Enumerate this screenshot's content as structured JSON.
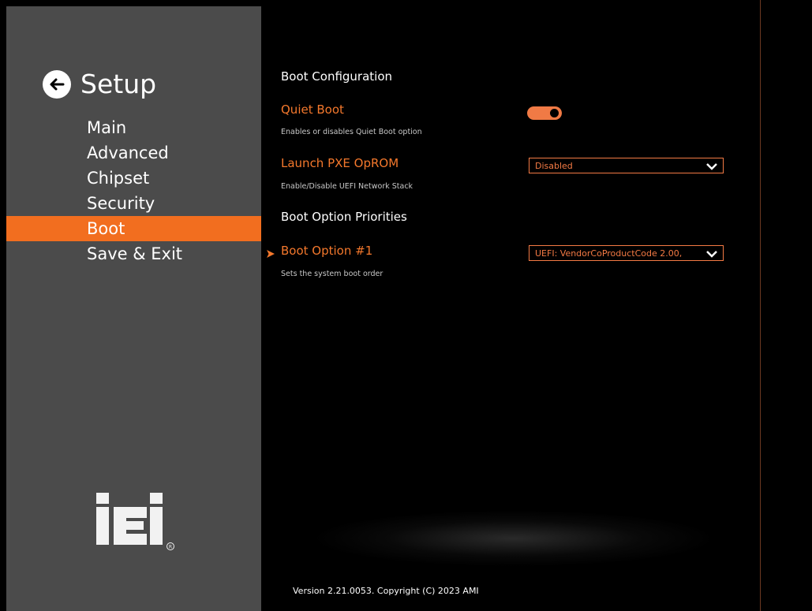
{
  "sidebar": {
    "title": "Setup",
    "items": [
      {
        "label": "Main"
      },
      {
        "label": "Advanced"
      },
      {
        "label": "Chipset"
      },
      {
        "label": "Security"
      },
      {
        "label": "Boot"
      },
      {
        "label": "Save & Exit"
      }
    ],
    "active_item": "Boot",
    "logo_text": "iEi"
  },
  "main": {
    "section_boot_config": "Boot Configuration",
    "quiet_boot": {
      "label": "Quiet Boot",
      "help": "Enables or disables Quiet Boot option",
      "enabled": true
    },
    "launch_pxe": {
      "label": "Launch PXE OpROM",
      "help": "Enable/Disable UEFI Network Stack",
      "value": "Disabled"
    },
    "section_priorities": "Boot Option Priorities",
    "boot_option_1": {
      "label": "Boot Option #1",
      "help": "Sets the system boot order",
      "value": "UEFI: VendorCoProductCode 2.00,"
    },
    "version": "Version 2.21.0053. Copyright (C) 2023 AMI"
  },
  "colors": {
    "accent": "#f26e1f",
    "sidebar_bg": "#4b4b4b",
    "background": "#000000"
  },
  "icons": {
    "back": "arrow-left-icon",
    "chevron": "chevron-down-icon",
    "submenu": "triangle-right-icon"
  }
}
